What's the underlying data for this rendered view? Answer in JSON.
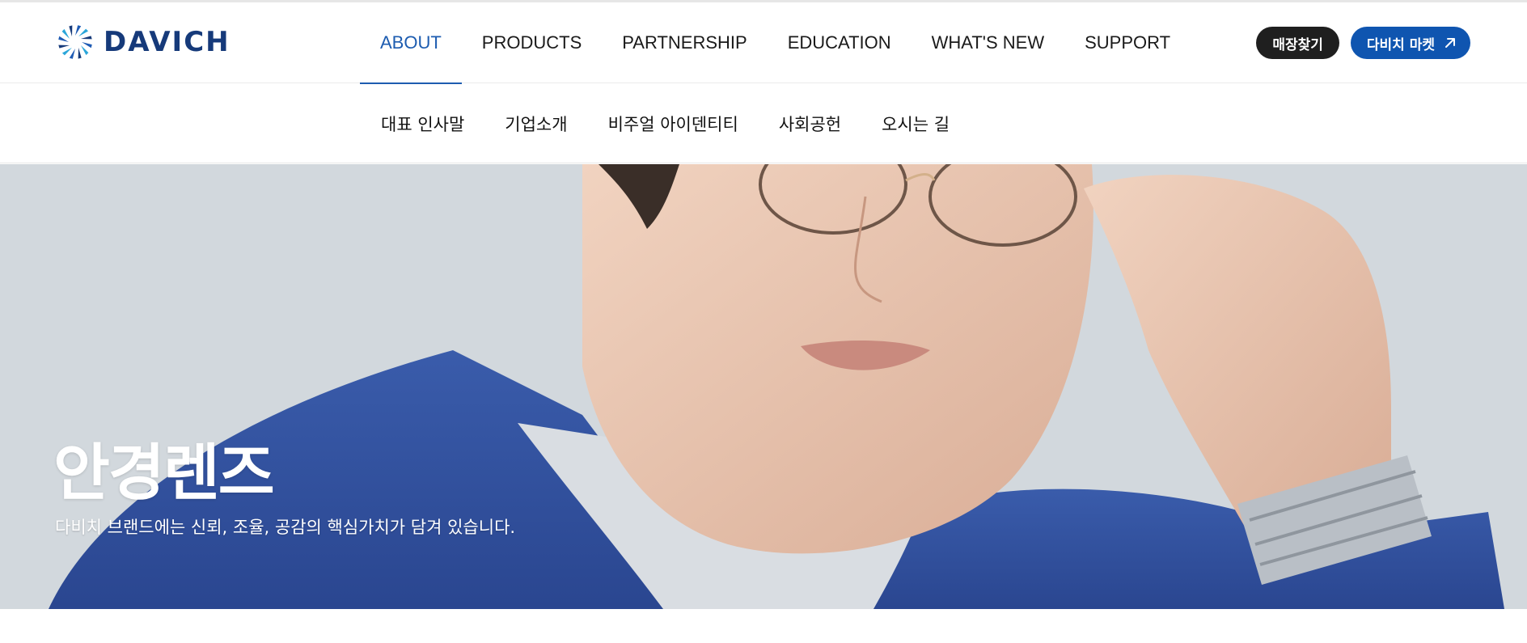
{
  "brand": {
    "name": "DAVICH",
    "logo_icon": "sunburst-logo-icon",
    "color": "#163a7a"
  },
  "gnb": {
    "items": [
      {
        "label": "ABOUT",
        "active": true
      },
      {
        "label": "PRODUCTS",
        "active": false
      },
      {
        "label": "PARTNERSHIP",
        "active": false
      },
      {
        "label": "EDUCATION",
        "active": false
      },
      {
        "label": "WHAT'S NEW",
        "active": false
      },
      {
        "label": "SUPPORT",
        "active": false
      }
    ],
    "active_color": "#1d5cb0"
  },
  "util": {
    "store_label": "매장찾기",
    "market_label": "다비치 마켓",
    "market_icon": "external-arrow-icon",
    "store_color": "#1f1f1f",
    "market_color": "#0f55b0"
  },
  "subnav": {
    "items": [
      "대표 인사말",
      "기업소개",
      "비주얼 아이덴티티",
      "사회공헌",
      "오시는 길"
    ]
  },
  "hero": {
    "title": "안경렌즈",
    "subtitle": "다비치 브랜드에는 신뢰, 조율, 공감의 핵심가치가 담겨 있습니다.",
    "image": "man-adjusting-glasses-photo",
    "background_color": "#d2d8dd",
    "jacket_color": "#2f4f9e"
  }
}
